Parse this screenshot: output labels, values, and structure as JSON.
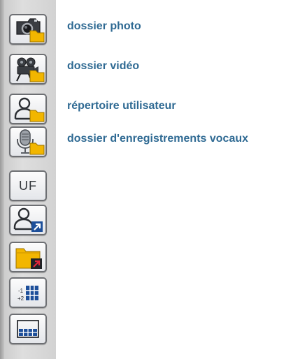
{
  "toolbar": {
    "buttons": [
      {
        "icon": "photo-folder-icon"
      },
      {
        "icon": "video-folder-icon"
      },
      {
        "icon": "user-directory-icon"
      },
      {
        "icon": "voice-recordings-folder-icon"
      },
      {
        "icon": "uf-icon",
        "text": "UF"
      },
      {
        "icon": "user-shortcut-icon"
      },
      {
        "icon": "folder-shortcut-icon"
      },
      {
        "icon": "numbered-list-icon"
      },
      {
        "icon": "grid-view-icon"
      }
    ]
  },
  "labels": {
    "photo_folder": "dossier photo",
    "video_folder": "dossier vidéo",
    "user_directory": "répertoire utilisateur",
    "voice_recordings_folder": "dossier d'enregistrements vocaux"
  },
  "colors": {
    "label_text": "#2f6a93",
    "folder_yellow": "#f2b600",
    "shortcut_blue": "#1d4f9a"
  }
}
